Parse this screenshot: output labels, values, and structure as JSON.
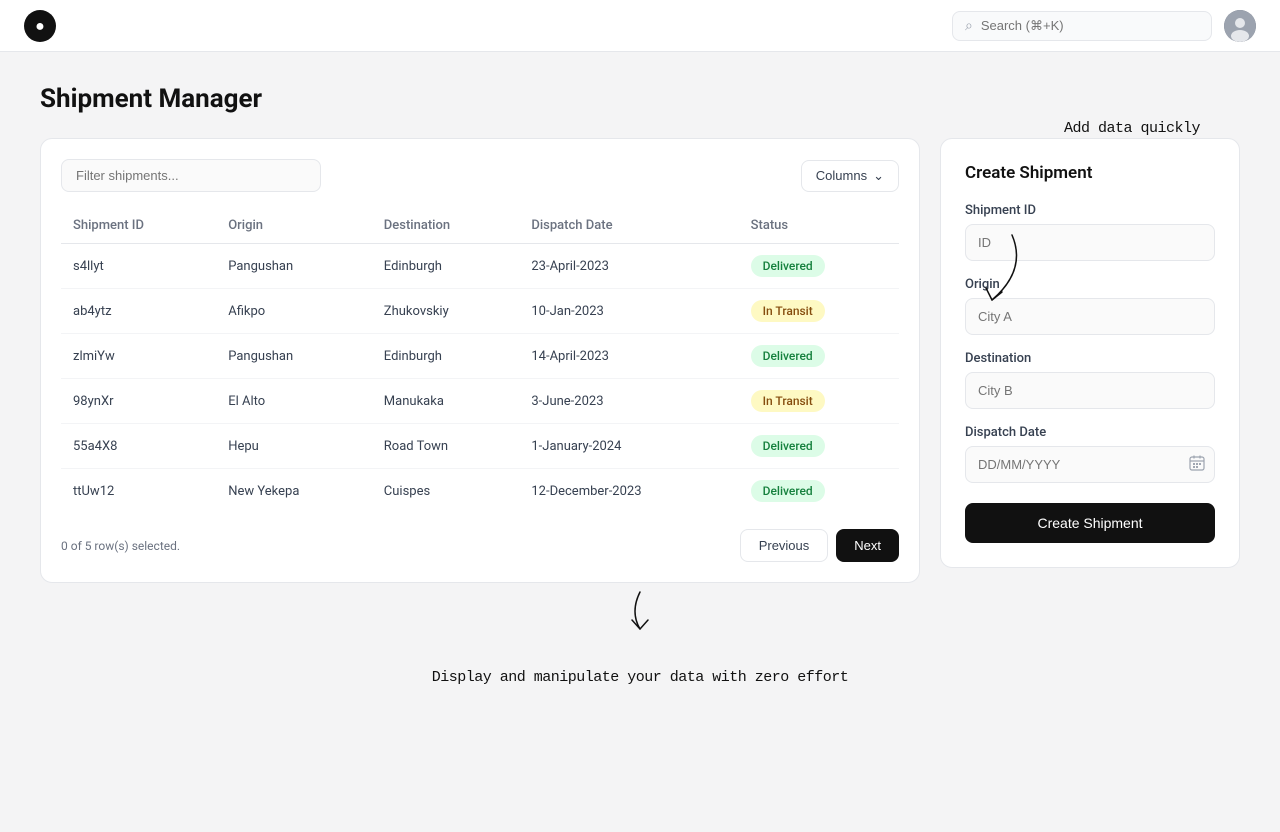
{
  "app": {
    "logo": "●",
    "search_placeholder": "Search (⌘+K)"
  },
  "page": {
    "title": "Shipment Manager"
  },
  "table": {
    "filter_placeholder": "Filter shipments...",
    "columns_button": "Columns",
    "headers": [
      "Shipment ID",
      "Origin",
      "Destination",
      "Dispatch Date",
      "Status"
    ],
    "rows": [
      {
        "id": "s4llyt",
        "origin": "Pangushan",
        "destination": "Edinburgh",
        "date": "23-April-2023",
        "status": "Delivered",
        "status_type": "delivered"
      },
      {
        "id": "ab4ytz",
        "origin": "Afikpo",
        "destination": "Zhukovskiy",
        "date": "10-Jan-2023",
        "status": "In Transit",
        "status_type": "in-transit"
      },
      {
        "id": "zlmiYw",
        "origin": "Pangushan",
        "destination": "Edinburgh",
        "date": "14-April-2023",
        "status": "Delivered",
        "status_type": "delivered"
      },
      {
        "id": "98ynXr",
        "origin": "El Alto",
        "destination": "Manukaka",
        "date": "3-June-2023",
        "status": "In Transit",
        "status_type": "in-transit"
      },
      {
        "id": "55a4X8",
        "origin": "Hepu",
        "destination": "Road Town",
        "date": "1-January-2024",
        "status": "Delivered",
        "status_type": "delivered"
      },
      {
        "id": "ttUw12",
        "origin": "New Yekepa",
        "destination": "Cuispes",
        "date": "12-December-2023",
        "status": "Delivered",
        "status_type": "delivered"
      }
    ],
    "row_count": "0 of 5 row(s) selected.",
    "prev_label": "Previous",
    "next_label": "Next"
  },
  "create_form": {
    "title": "Create Shipment",
    "id_label": "Shipment ID",
    "id_placeholder": "ID",
    "origin_label": "Origin",
    "origin_placeholder": "City A",
    "destination_label": "Destination",
    "destination_placeholder": "City B",
    "date_label": "Dispatch Date",
    "date_placeholder": "DD/MM/YYYY",
    "submit_label": "Create Shipment"
  },
  "annotations": {
    "top": "Add data quickly",
    "bottom": "Display and manipulate your data with zero effort"
  }
}
